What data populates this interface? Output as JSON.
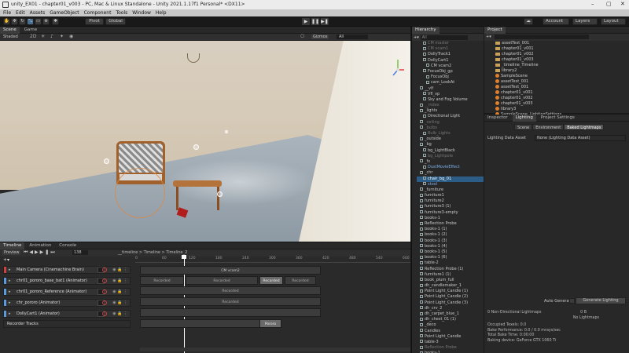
{
  "window": {
    "title": "unity_EX01 - chapter01_v003 - PC, Mac & Linux Standalone - Unity 2021.1.17f1 Personal* <DX11>",
    "controls": [
      "–",
      "▢",
      "✕"
    ]
  },
  "menu": [
    "File",
    "Edit",
    "Assets",
    "GameObject",
    "Component",
    "Tools",
    "Window",
    "Help"
  ],
  "toolbar": {
    "pivot": "Pivot",
    "global": "Global",
    "account": "Account",
    "layers": "Layers",
    "layout": "Layout"
  },
  "scene": {
    "tabs": [
      "Scene",
      "Game"
    ],
    "shading": "Shaded",
    "gizmos": "Gizmos",
    "all": "All"
  },
  "hierarchy": {
    "tab": "Hierarchy",
    "search": "All",
    "items": [
      "CM master",
      "CM vcam1",
      "DollyTrack1",
      "DollyCart1",
      "CM vcam2",
      "FocusObj_gp",
      "FocusObj",
      "cam_LookAt",
      "__vlf",
      "Vfl_vp",
      "Sky and Fog Volume",
      "__index",
      "_lights",
      "Directional Light",
      "_ceiling",
      "_bulbs",
      "Bulb_Lights",
      "_outside",
      "_bg",
      "bg_LightBlack",
      "bg_Lightpole",
      "_fx",
      "DustMovieEffect",
      "_chr",
      "chair_bg_01",
      "stool",
      "_furniture",
      "furniture1",
      "furniture2",
      "furniture3 (1)",
      "furniture3-empty",
      "books-1",
      "Reflection Probe",
      "books-1 (1)",
      "books-1 (2)",
      "books-1 (3)",
      "books-1 (4)",
      "books-1 (5)",
      "books-1 (6)",
      "table-2",
      "Reflection Probe (1)",
      "furniture1 (1)",
      "book_plum_full",
      "dh_candlemaker_1",
      "Point Light_Candle (1)",
      "Point Light_Candle (2)",
      "Point Light_Candle (3)",
      "dh_crv_2",
      "dh_carpet_blue_1",
      "dh_chest_01 (1)",
      "_deco",
      "Candles",
      "Point Light_Candle",
      "table-3",
      "Reflection Probe",
      "books-1",
      "hourglass",
      "chair_01"
    ]
  },
  "project": {
    "tab": "Project",
    "items": [
      "assetTest_001",
      "chapter01_v001",
      "chapter01_v002",
      "chapter01_v003",
      "_timeline_Timeline",
      "library2",
      "SampleScene",
      "assetTest_001",
      "assetTest_001",
      "chapter01_v001",
      "chapter01_v002",
      "chapter01_v003",
      "library3",
      "SampleScene_LightingSettings"
    ]
  },
  "inspector": {
    "tabs": [
      "Inspector",
      "Lighting",
      "Project Settings"
    ],
    "subtabs": [
      "Scene",
      "Environment",
      "Baked Lightmaps"
    ],
    "lighting_data_label": "Lighting Data Asset",
    "lighting_data_value": "None (Lighting Data Asset)",
    "auto_generate": "Auto Generate",
    "generate_button": "Generate Lighting",
    "stats": [
      [
        "0 Non-Directional Lightmaps",
        "0 B"
      ],
      [
        "",
        "No Lightmaps"
      ],
      [
        "Occupied Texels: 0.0",
        ""
      ],
      [
        "Bake Performance: 0.0 / 0.0 mrays/sec",
        ""
      ],
      [
        "Total Bake Time: 0:00:00",
        ""
      ],
      [
        "Baking device: GeForce GTX 1060 Ti",
        ""
      ]
    ]
  },
  "timeline": {
    "tabs": [
      "Timeline",
      "Animation",
      "Console"
    ],
    "preview": "Preview",
    "frame": "138",
    "breadcrumb": "__timeline > Timeline > Timeline_2",
    "ruler": [
      "0",
      "60",
      "120",
      "180",
      "240",
      "300",
      "360",
      "420",
      "480",
      "540",
      "600"
    ],
    "tracks": [
      {
        "name": "Main Camera (Cinemachine Brain)",
        "color": "#d04040"
      },
      {
        "name": "chr01_pororo_base_bat1 (Animator)",
        "color": "#5a9adf"
      },
      {
        "name": "chr01_pororo_Reference (Animator)",
        "color": "#5a9adf"
      },
      {
        "name": "chr_pororo (Animator)",
        "color": "#5a9adf"
      },
      {
        "name": "DollyCart1 (Animator)",
        "color": "#5a9adf"
      }
    ],
    "clips": {
      "cam": "CM vcam2",
      "t2a": "Recorded",
      "t2b": "Recorded",
      "t2c": "Recorded",
      "t2d": "Recorded",
      "t3": "Recorded",
      "t4": "Recorded",
      "t6": "Pororo"
    },
    "group": "Recorder Tracks"
  }
}
